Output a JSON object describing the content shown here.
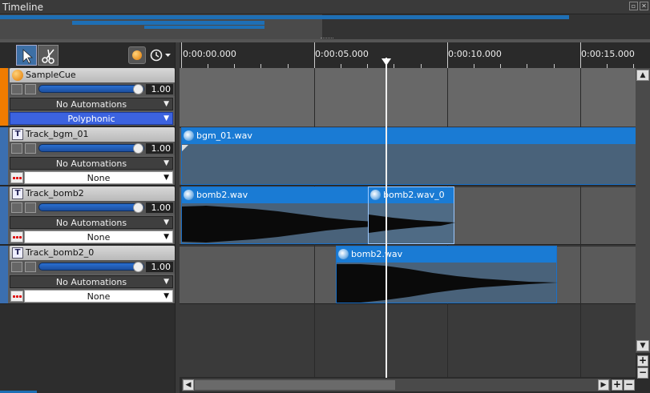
{
  "window": {
    "title": "Timeline"
  },
  "toolbar": {
    "select_tool": "pointer-icon",
    "cut_tool": "scissors-icon"
  },
  "ruler": {
    "labels": [
      "0:00:00.000",
      "0:00:05.000",
      "0:00:10.000",
      "0:00:15.000"
    ]
  },
  "cue": {
    "name": "SampleCue",
    "volume": "1.00",
    "automation": "No Automations",
    "mode": "Polyphonic"
  },
  "tracks": [
    {
      "name": "Track_bgm_01",
      "volume": "1.00",
      "automation": "No Automations",
      "sequence": "None"
    },
    {
      "name": "Track_bomb2",
      "volume": "1.00",
      "automation": "No Automations",
      "sequence": "None"
    },
    {
      "name": "Track_bomb2_0",
      "volume": "1.00",
      "automation": "No Automations",
      "sequence": "None"
    }
  ],
  "clips": [
    {
      "name": "bgm_01.wav"
    },
    {
      "name": "bomb2.wav"
    },
    {
      "name": "bomb2.wav_0"
    },
    {
      "name": "bomb2.wav"
    }
  ],
  "colors": {
    "cue_accent": "#f07c00",
    "track_accent": "#3b6fb0",
    "clip_header": "#1a7bd4",
    "mode_blue": "#3c63e0"
  }
}
